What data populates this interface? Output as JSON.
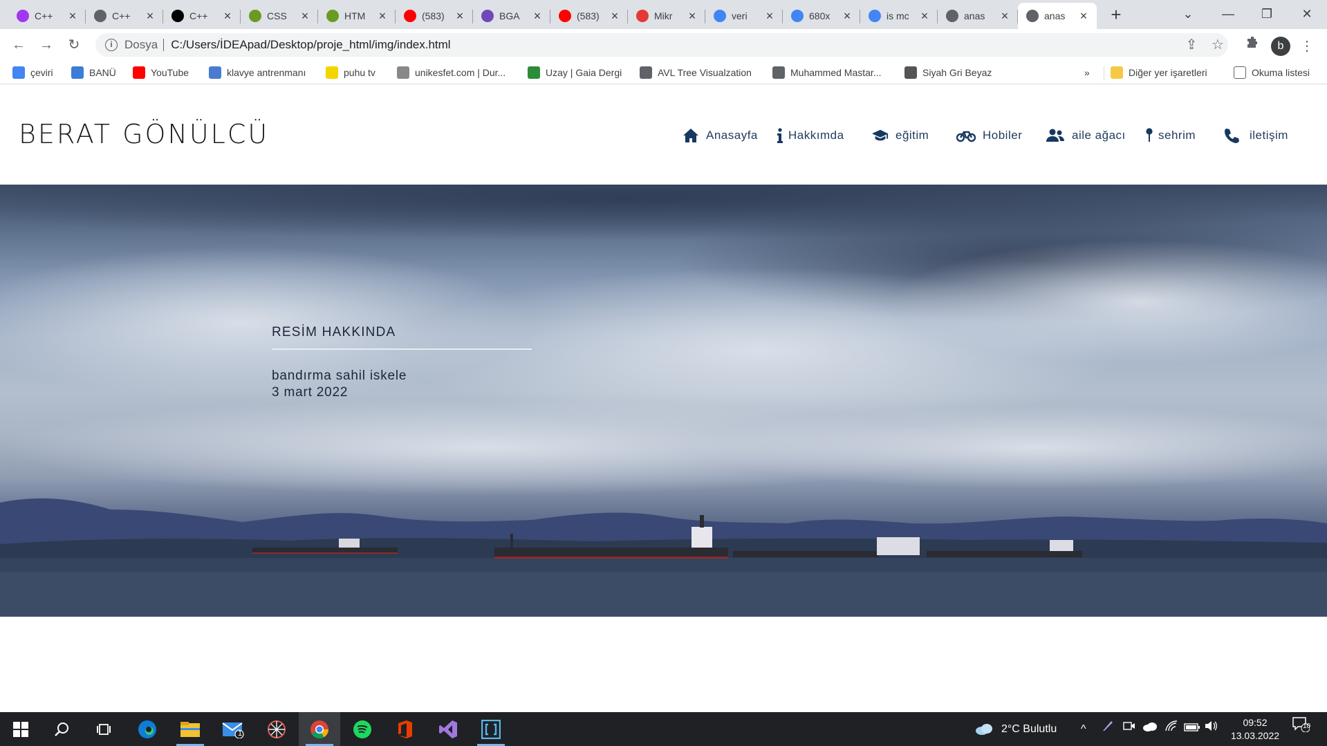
{
  "browser": {
    "tabs": [
      {
        "title": "C++",
        "favicon": "udemy-icon",
        "color": "#a435f0"
      },
      {
        "title": "C++",
        "favicon": "globe-icon",
        "color": "#5f6368"
      },
      {
        "title": "C++",
        "favicon": "medium-icon",
        "color": "#000000"
      },
      {
        "title": "CSS",
        "favicon": "bug-icon",
        "color": "#6a9a23"
      },
      {
        "title": "HTM",
        "favicon": "bug-icon",
        "color": "#6a9a23"
      },
      {
        "title": "(583)",
        "favicon": "youtube-icon",
        "color": "#ff0000"
      },
      {
        "title": "BGA",
        "favicon": "list-icon",
        "color": "#7248b9"
      },
      {
        "title": "(583)",
        "favicon": "youtube-icon",
        "color": "#ff0000"
      },
      {
        "title": "Mikr",
        "favicon": "dh-icon",
        "color": "#e53935"
      },
      {
        "title": "veri",
        "favicon": "google-icon",
        "color": "#4285f4"
      },
      {
        "title": "680x",
        "favicon": "google-icon",
        "color": "#4285f4"
      },
      {
        "title": "is mc",
        "favicon": "google-icon",
        "color": "#4285f4"
      },
      {
        "title": "anas",
        "favicon": "globe-icon",
        "color": "#5f6368"
      },
      {
        "title": "anas",
        "favicon": "globe-icon",
        "color": "#5f6368",
        "active": true
      }
    ],
    "scheme_label": "Dosya",
    "url": "C:/Users/İDEApad/Desktop/proje_html/img/index.html",
    "profile_initial": "b",
    "bookmarks": [
      {
        "label": "çeviri",
        "icon": "translate-icon",
        "color": "#4285f4"
      },
      {
        "label": "BANÜ",
        "icon": "banu-icon",
        "color": "#3b7dd8"
      },
      {
        "label": "YouTube",
        "icon": "youtube-icon",
        "color": "#ff0000"
      },
      {
        "label": "klavye antrenmanı",
        "icon": "drop-icon",
        "color": "#4a7bd0"
      },
      {
        "label": "puhu tv",
        "icon": "puhu-icon",
        "color": "#f2d600"
      },
      {
        "label": "unikesfet.com | Dur...",
        "icon": "uk-icon",
        "color": "#888888"
      },
      {
        "label": "Uzay | Gaia Dergi",
        "icon": "gaia-icon",
        "color": "#2e8b3a"
      },
      {
        "label": "AVL Tree Visualzation",
        "icon": "globe-icon",
        "color": "#5f6368"
      },
      {
        "label": "Muhammed Mastar...",
        "icon": "globe-icon",
        "color": "#5f6368"
      },
      {
        "label": "Siyah Gri Beyaz",
        "icon": "image-icon",
        "color": "#555555"
      }
    ],
    "overflow_label": "»",
    "other_bookmarks": "Diğer yer işaretleri",
    "reading_list": "Okuma listesi"
  },
  "site": {
    "logo": "BERAT GÖNÜLCÜ",
    "nav": [
      {
        "label": "Anasayfa",
        "icon": "home-icon"
      },
      {
        "label": "Hakkımda",
        "icon": "info-icon"
      },
      {
        "label": "eğitim",
        "icon": "graduation-cap-icon"
      },
      {
        "label": "Hobiler",
        "icon": "bicycle-icon"
      },
      {
        "label": "aile ağacı",
        "icon": "users-icon"
      },
      {
        "label": "sehrim",
        "icon": "map-pin-icon"
      },
      {
        "label": "iletişim",
        "icon": "phone-icon"
      }
    ],
    "caption": {
      "title": "RESİM HAKKINDA",
      "line1": "bandırma sahil iskele",
      "line2": "3 mart 2022"
    }
  },
  "taskbar": {
    "apps": [
      "windows-start-icon",
      "search-icon",
      "task-view-icon",
      "edge-icon",
      "file-explorer-icon",
      "mail-icon",
      "spider-app-icon",
      "chrome-icon",
      "spotify-icon",
      "office-icon",
      "visual-studio-icon",
      "bracket-app-icon"
    ],
    "mail_badge": "1",
    "weather": "2°C  Bulutlu",
    "time": "09:52",
    "date": "13.03.2022",
    "notifications": "10"
  },
  "colors": {
    "nav_text": "#1f3a5c",
    "nav_icon": "#17385f",
    "caption_text": "#1e2538"
  }
}
